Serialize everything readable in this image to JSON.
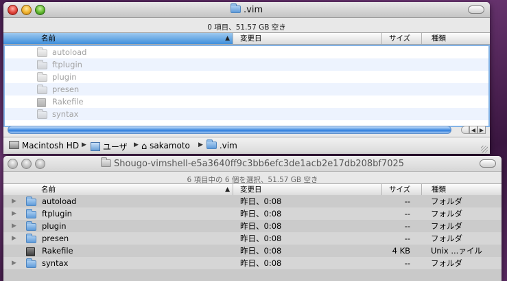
{
  "window1": {
    "title": ".vim",
    "status": "0 項目、51.57 GB 空き",
    "columns": {
      "name": "名前",
      "date": "変更日",
      "size": "サイズ",
      "kind": "種類"
    },
    "items": [
      {
        "name": "autoload",
        "icon": "folder-icon"
      },
      {
        "name": "ftplugin",
        "icon": "folder-icon"
      },
      {
        "name": "plugin",
        "icon": "folder-icon"
      },
      {
        "name": "presen",
        "icon": "folder-icon"
      },
      {
        "name": "Rakefile",
        "icon": "file-icon"
      },
      {
        "name": "syntax",
        "icon": "folder-icon"
      }
    ],
    "path": [
      {
        "label": "Macintosh HD",
        "icon": "hard-drive-icon"
      },
      {
        "label": "ユーザ",
        "icon": "users-folder-icon"
      },
      {
        "label": "sakamoto",
        "icon": "home-icon"
      },
      {
        "label": ".vim",
        "icon": "folder-icon"
      }
    ]
  },
  "window2": {
    "title": "Shougo-vimshell-e5a3640ff9c3bb6efc3de1acb2e17db208bf7025",
    "status": "6 項目中の 6 個を選択、51.57 GB 空き",
    "columns": {
      "name": "名前",
      "date": "変更日",
      "size": "サイズ",
      "kind": "種類"
    },
    "items": [
      {
        "name": "autoload",
        "date": "昨日、0:08",
        "size": "--",
        "kind": "フォルダ",
        "icon": "folder-icon"
      },
      {
        "name": "ftplugin",
        "date": "昨日、0:08",
        "size": "--",
        "kind": "フォルダ",
        "icon": "folder-icon"
      },
      {
        "name": "plugin",
        "date": "昨日、0:08",
        "size": "--",
        "kind": "フォルダ",
        "icon": "folder-icon"
      },
      {
        "name": "presen",
        "date": "昨日、0:08",
        "size": "--",
        "kind": "フォルダ",
        "icon": "folder-icon"
      },
      {
        "name": "Rakefile",
        "date": "昨日、0:08",
        "size": "4 KB",
        "kind": "Unix ...ァイル",
        "icon": "file-icon"
      },
      {
        "name": "syntax",
        "date": "昨日、0:08",
        "size": "--",
        "kind": "フォルダ",
        "icon": "folder-icon"
      }
    ]
  }
}
